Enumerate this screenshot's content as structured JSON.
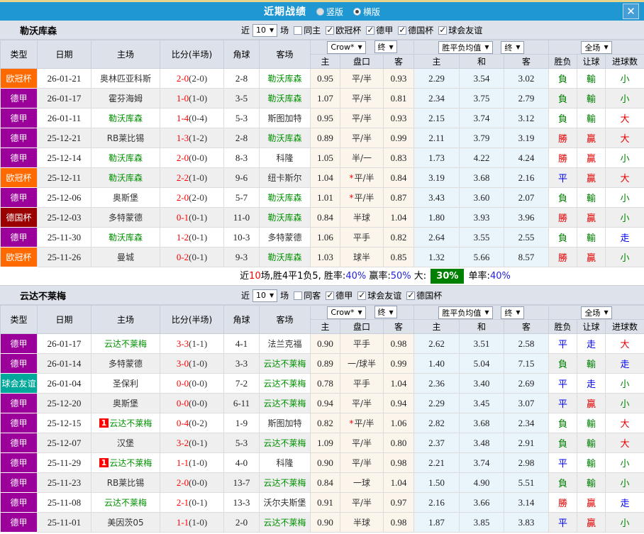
{
  "header": {
    "title": "近期战绩",
    "radio_vertical": "竖版",
    "radio_horizontal": "横版",
    "selected_layout": "横版",
    "close": "✕"
  },
  "icons": {
    "caret": "▼",
    "check": "✓",
    "close": "✕"
  },
  "colors": {
    "title_bar": "#1e97d3",
    "top_strip": "#e8d58d",
    "type_badges": {
      "欧冠杯": "#ff6a00",
      "德甲": "#9b009b",
      "德国杯": "#9a0000",
      "球会友谊": "#00a79b"
    },
    "result_win_red": "#e50000",
    "result_lose_green": "#008000",
    "result_draw_blue": "#0000ee",
    "highlight_team_green": "#009100",
    "score_red": "#ff0000",
    "rate_badge_green": "#008000"
  },
  "table_headers": {
    "cols": [
      "类型",
      "日期",
      "主场",
      "比分(半场)",
      "角球",
      "客场"
    ],
    "subs": [
      "主",
      "盘口",
      "客",
      "主",
      "和",
      "客",
      "胜负",
      "让球",
      "进球数"
    ],
    "dropdowns": {
      "book": "Crow*",
      "end": "终",
      "avg": "胜平负均值",
      "full": "全场"
    }
  },
  "filter_labels": {
    "near": "近",
    "count": "10",
    "unit": "场"
  },
  "sections": [
    {
      "team": "勒沃库森",
      "filter": {
        "same_label": "同主",
        "same_checked": false,
        "leagues": [
          "欧冠杯",
          "德甲",
          "德国杯",
          "球会友谊"
        ]
      },
      "rows": [
        [
          "欧冠杯",
          "26-01-21",
          "奥林匹亚科斯",
          "",
          "2-0",
          "(2-0)",
          "2-8",
          "勒沃库森",
          "hl",
          "0.95",
          "平/半",
          "0.93",
          "2.29",
          "3.54",
          "3.02",
          "負",
          "輸",
          "小"
        ],
        [
          "德甲",
          "26-01-17",
          "霍芬海姆",
          "",
          "1-0",
          "(1-0)",
          "3-5",
          "勒沃库森",
          "hl",
          "1.07",
          "平/半",
          "0.81",
          "2.34",
          "3.75",
          "2.79",
          "負",
          "輸",
          "小"
        ],
        [
          "德甲",
          "26-01-11",
          "勒沃库森",
          "hl",
          "1-4",
          "(0-4)",
          "5-3",
          "斯图加特",
          "",
          "0.95",
          "平/半",
          "0.93",
          "2.15",
          "3.74",
          "3.12",
          "負",
          "輸",
          "大"
        ],
        [
          "德甲",
          "25-12-21",
          "RB莱比锡",
          "",
          "1-3",
          "(1-2)",
          "2-8",
          "勒沃库森",
          "hl",
          "0.89",
          "平/半",
          "0.99",
          "2.11",
          "3.79",
          "3.19",
          "勝",
          "贏",
          "大"
        ],
        [
          "德甲",
          "25-12-14",
          "勒沃库森",
          "hl",
          "2-0",
          "(0-0)",
          "8-3",
          "科隆",
          "",
          "1.05",
          "半/一",
          "0.83",
          "1.73",
          "4.22",
          "4.24",
          "勝",
          "贏",
          "小"
        ],
        [
          "欧冠杯",
          "25-12-11",
          "勒沃库森",
          "hl",
          "2-2",
          "(1-0)",
          "9-6",
          "纽卡斯尔",
          "",
          "1.04",
          "*平/半",
          "0.84",
          "3.19",
          "3.68",
          "2.16",
          "平",
          "贏",
          "大"
        ],
        [
          "德甲",
          "25-12-06",
          "奥斯堡",
          "",
          "2-0",
          "(2-0)",
          "5-7",
          "勒沃库森",
          "hl",
          "1.01",
          "*平/半",
          "0.87",
          "3.43",
          "3.60",
          "2.07",
          "負",
          "輸",
          "小"
        ],
        [
          "德国杯",
          "25-12-03",
          "多特蒙德",
          "",
          "0-1",
          "(0-1)",
          "11-0",
          "勒沃库森",
          "hl",
          "0.84",
          "半球",
          "1.04",
          "1.80",
          "3.93",
          "3.96",
          "勝",
          "贏",
          "小"
        ],
        [
          "德甲",
          "25-11-30",
          "勒沃库森",
          "hl",
          "1-2",
          "(0-1)",
          "10-3",
          "多特蒙德",
          "",
          "1.06",
          "平手",
          "0.82",
          "2.64",
          "3.55",
          "2.55",
          "負",
          "輸",
          "走"
        ],
        [
          "欧冠杯",
          "25-11-26",
          "曼城",
          "",
          "0-2",
          "(0-1)",
          "9-3",
          "勒沃库森",
          "hl",
          "1.03",
          "球半",
          "0.85",
          "1.32",
          "5.66",
          "8.57",
          "勝",
          "贏",
          "小"
        ]
      ],
      "summary": [
        {
          "t": "近",
          "c": "k"
        },
        {
          "t": "10",
          "c": "r"
        },
        {
          "t": "场,胜4平1负5, 胜率:",
          "c": "k"
        },
        {
          "t": "40%",
          "c": "b"
        },
        {
          "t": " 赢率:",
          "c": "k"
        },
        {
          "t": "50%",
          "c": "b"
        },
        {
          "t": " 大: ",
          "c": "k"
        },
        {
          "t": "30%",
          "c": "hl"
        },
        {
          "t": " 单率:",
          "c": "k"
        },
        {
          "t": "40%",
          "c": "b"
        }
      ]
    },
    {
      "team": "云达不莱梅",
      "filter": {
        "same_label": "同客",
        "same_checked": false,
        "leagues": [
          "德甲",
          "球会友谊",
          "德国杯"
        ]
      },
      "rows": [
        [
          "德甲",
          "26-01-17",
          "云达不莱梅",
          "hl",
          "3-3",
          "(1-1)",
          "4-1",
          "法兰克福",
          "",
          "0.90",
          "平手",
          "0.98",
          "2.62",
          "3.51",
          "2.58",
          "平",
          "走",
          "大"
        ],
        [
          "德甲",
          "26-01-14",
          "多特蒙德",
          "",
          "3-0",
          "(1-0)",
          "3-3",
          "云达不莱梅",
          "hl",
          "0.89",
          "一/球半",
          "0.99",
          "1.40",
          "5.04",
          "7.15",
          "負",
          "輸",
          "走"
        ],
        [
          "球会友谊",
          "26-01-04",
          "圣保利",
          "",
          "0-0",
          "(0-0)",
          "7-2",
          "云达不莱梅",
          "hl",
          "0.78",
          "平手",
          "1.04",
          "2.36",
          "3.40",
          "2.69",
          "平",
          "走",
          "小"
        ],
        [
          "德甲",
          "25-12-20",
          "奥斯堡",
          "",
          "0-0",
          "(0-0)",
          "6-11",
          "云达不莱梅",
          "hl",
          "0.94",
          "平/半",
          "0.94",
          "2.29",
          "3.45",
          "3.07",
          "平",
          "贏",
          "小"
        ],
        [
          "德甲",
          "25-12-15",
          "云达不莱梅",
          "hl1",
          "0-4",
          "(0-2)",
          "1-9",
          "斯图加特",
          "",
          "0.82",
          "*平/半",
          "1.06",
          "2.82",
          "3.68",
          "2.34",
          "負",
          "輸",
          "大"
        ],
        [
          "德甲",
          "25-12-07",
          "汉堡",
          "",
          "3-2",
          "(0-1)",
          "5-3",
          "云达不莱梅",
          "hl",
          "1.09",
          "平/半",
          "0.80",
          "2.37",
          "3.48",
          "2.91",
          "負",
          "輸",
          "大"
        ],
        [
          "德甲",
          "25-11-29",
          "云达不莱梅",
          "hl1",
          "1-1",
          "(1-0)",
          "4-0",
          "科隆",
          "",
          "0.90",
          "平/半",
          "0.98",
          "2.21",
          "3.74",
          "2.98",
          "平",
          "輸",
          "小"
        ],
        [
          "德甲",
          "25-11-23",
          "RB莱比锡",
          "",
          "2-0",
          "(0-0)",
          "13-7",
          "云达不莱梅",
          "hl",
          "0.84",
          "一球",
          "1.04",
          "1.50",
          "4.90",
          "5.51",
          "負",
          "輸",
          "小"
        ],
        [
          "德甲",
          "25-11-08",
          "云达不莱梅",
          "hl",
          "2-1",
          "(0-1)",
          "13-3",
          "沃尔夫斯堡",
          "",
          "0.91",
          "平/半",
          "0.97",
          "2.16",
          "3.66",
          "3.14",
          "勝",
          "贏",
          "走"
        ],
        [
          "德甲",
          "25-11-01",
          "美因茨05",
          "",
          "1-1",
          "(1-0)",
          "2-0",
          "云达不莱梅",
          "hl",
          "0.90",
          "半球",
          "0.98",
          "1.87",
          "3.85",
          "3.83",
          "平",
          "贏",
          "小"
        ]
      ],
      "summary": null
    }
  ]
}
